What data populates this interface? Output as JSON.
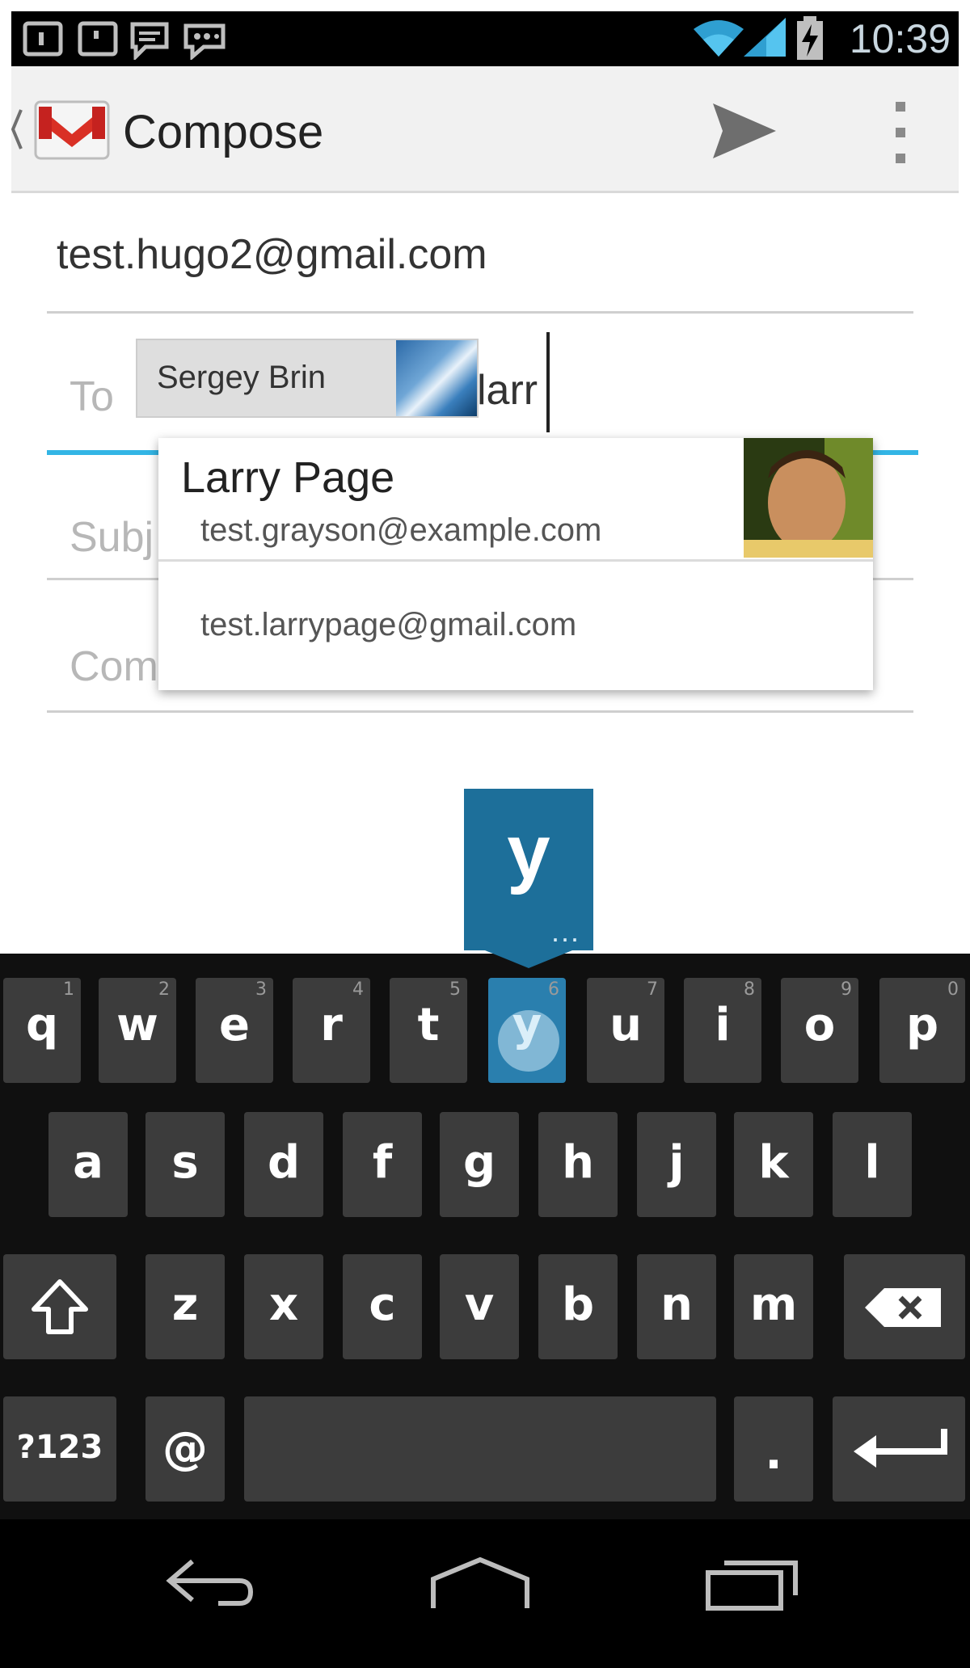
{
  "status_bar": {
    "time": "10:39",
    "icons": [
      "notification-icon",
      "notification-icon",
      "chat-icon",
      "talk-icon",
      "wifi-icon",
      "signal-icon",
      "battery-charging-icon"
    ]
  },
  "action_bar": {
    "title": "Compose",
    "app_icon": "gmail-icon",
    "send_icon": "send-icon",
    "overflow_icon": "overflow-menu-icon"
  },
  "compose": {
    "from": "test.hugo2@gmail.com",
    "to_label": "To",
    "recipient_chip": "Sergey Brin",
    "to_typed": "larr",
    "subject_hint": "Subj",
    "compose_hint": "Com"
  },
  "suggestions": [
    {
      "name": "Larry Page",
      "email": "test.grayson@example.com"
    },
    {
      "email": "test.larrypage@gmail.com"
    }
  ],
  "key_preview": {
    "letter": "y",
    "more": "..."
  },
  "keyboard": {
    "row1": [
      {
        "k": "q",
        "hint": "1"
      },
      {
        "k": "w",
        "hint": "2"
      },
      {
        "k": "e",
        "hint": "3"
      },
      {
        "k": "r",
        "hint": "4"
      },
      {
        "k": "t",
        "hint": "5"
      },
      {
        "k": "y",
        "hint": "6"
      },
      {
        "k": "u",
        "hint": "7"
      },
      {
        "k": "i",
        "hint": "8"
      },
      {
        "k": "o",
        "hint": "9"
      },
      {
        "k": "p",
        "hint": "0"
      }
    ],
    "row2": [
      "a",
      "s",
      "d",
      "f",
      "g",
      "h",
      "j",
      "k",
      "l"
    ],
    "row3": [
      "z",
      "x",
      "c",
      "v",
      "b",
      "n",
      "m"
    ],
    "symbols": "?123",
    "at": "@",
    "period": ".",
    "shift_icon": "shift-icon",
    "delete_icon": "backspace-icon",
    "enter_icon": "enter-icon",
    "active_key": "y"
  },
  "nav_bar": {
    "back_icon": "back-icon",
    "home_icon": "home-icon",
    "recents_icon": "recent-apps-icon"
  },
  "colors": {
    "accent": "#33b5e5",
    "key_active": "#2a7fae",
    "keyboard_bg": "#101010",
    "key_bg": "#3c3c3c"
  }
}
